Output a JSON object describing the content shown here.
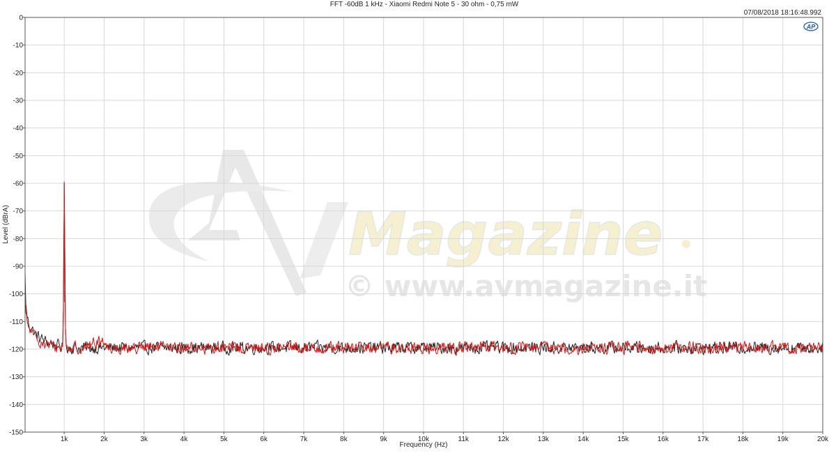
{
  "chart_data": {
    "type": "line",
    "title": "FFT -60dB 1 kHz - Xiaomi Redmi Note 5 - 30 ohm - 0,75 mW",
    "timestamp": "07/08/2018 18:16:48.992",
    "xlabel": "Frequency (Hz)",
    "ylabel": "Level (dBrA)",
    "xlim": [
      20,
      20000
    ],
    "ylim": [
      -150,
      0
    ],
    "x_ticks": [
      {
        "value": 1000,
        "label": "1k"
      },
      {
        "value": 2000,
        "label": "2k"
      },
      {
        "value": 3000,
        "label": "3k"
      },
      {
        "value": 4000,
        "label": "4k"
      },
      {
        "value": 5000,
        "label": "5k"
      },
      {
        "value": 6000,
        "label": "6k"
      },
      {
        "value": 7000,
        "label": "7k"
      },
      {
        "value": 8000,
        "label": "8k"
      },
      {
        "value": 9000,
        "label": "9k"
      },
      {
        "value": 10000,
        "label": "10k"
      },
      {
        "value": 11000,
        "label": "11k"
      },
      {
        "value": 12000,
        "label": "12k"
      },
      {
        "value": 13000,
        "label": "13k"
      },
      {
        "value": 14000,
        "label": "14k"
      },
      {
        "value": 15000,
        "label": "15k"
      },
      {
        "value": 16000,
        "label": "16k"
      },
      {
        "value": 17000,
        "label": "17k"
      },
      {
        "value": 18000,
        "label": "18k"
      },
      {
        "value": 19000,
        "label": "19k"
      },
      {
        "value": 20000,
        "label": "20k"
      }
    ],
    "y_ticks": [
      0,
      -10,
      -20,
      -30,
      -40,
      -50,
      -60,
      -70,
      -80,
      -90,
      -100,
      -110,
      -120,
      -130,
      -140,
      -150
    ],
    "grid": true,
    "series": [
      {
        "color": "#222222",
        "points": [
          [
            20,
            -93
          ],
          [
            30,
            -101
          ],
          [
            50,
            -106
          ],
          [
            80,
            -109
          ],
          [
            120,
            -111
          ],
          [
            200,
            -113
          ],
          [
            300,
            -115
          ],
          [
            400,
            -116
          ],
          [
            500,
            -117
          ],
          [
            600,
            -117.5
          ],
          [
            700,
            -118
          ],
          [
            800,
            -118.5
          ],
          [
            900,
            -119
          ],
          [
            960,
            -119
          ],
          [
            990,
            -100
          ],
          [
            1000,
            -60
          ],
          [
            1010,
            -100
          ],
          [
            1040,
            -119
          ],
          [
            1200,
            -119.5
          ],
          [
            1500,
            -119.5
          ],
          [
            2000,
            -119.5
          ],
          [
            3000,
            -119.5
          ],
          [
            4000,
            -119.5
          ],
          [
            5000,
            -119.5
          ],
          [
            6000,
            -119.5
          ],
          [
            7000,
            -119.5
          ],
          [
            8000,
            -119.5
          ],
          [
            9000,
            -119.5
          ],
          [
            10000,
            -119.5
          ],
          [
            11000,
            -119.5
          ],
          [
            12000,
            -119.5
          ],
          [
            13000,
            -119.5
          ],
          [
            14000,
            -119.5
          ],
          [
            15000,
            -119.5
          ],
          [
            16000,
            -119.5
          ],
          [
            17000,
            -119.5
          ],
          [
            18000,
            -119.5
          ],
          [
            19000,
            -119.5
          ],
          [
            20000,
            -119.5
          ]
        ]
      },
      {
        "color": "#dd1111",
        "points": [
          [
            20,
            -103
          ],
          [
            30,
            -106
          ],
          [
            50,
            -109
          ],
          [
            80,
            -111
          ],
          [
            120,
            -112.5
          ],
          [
            200,
            -114.5
          ],
          [
            300,
            -116
          ],
          [
            400,
            -117
          ],
          [
            500,
            -118
          ],
          [
            600,
            -118.5
          ],
          [
            700,
            -119
          ],
          [
            800,
            -119.5
          ],
          [
            900,
            -119.5
          ],
          [
            960,
            -119.5
          ],
          [
            990,
            -95
          ],
          [
            1000,
            -59.5
          ],
          [
            1010,
            -95
          ],
          [
            1040,
            -119.5
          ],
          [
            1200,
            -119.5
          ],
          [
            1500,
            -119.5
          ],
          [
            2000,
            -116.5
          ],
          [
            2050,
            -119.5
          ],
          [
            3000,
            -119.5
          ],
          [
            4000,
            -119.5
          ],
          [
            5000,
            -119.5
          ],
          [
            6000,
            -119.5
          ],
          [
            7000,
            -119.5
          ],
          [
            8000,
            -119.5
          ],
          [
            9000,
            -119.5
          ],
          [
            10000,
            -119.5
          ],
          [
            11000,
            -119.5
          ],
          [
            12000,
            -119.5
          ],
          [
            13000,
            -119.5
          ],
          [
            14000,
            -119.5
          ],
          [
            15000,
            -119.5
          ],
          [
            16000,
            -119.5
          ],
          [
            17000,
            -119.5
          ],
          [
            18000,
            -119.5
          ],
          [
            19000,
            -119.5
          ],
          [
            20000,
            -119.5
          ]
        ]
      }
    ],
    "noise_amplitude_db": 3
  },
  "logo": {
    "corner_label": "AP",
    "watermark_brand": "Magazine",
    "watermark_url": "© www.avmagazine.it"
  },
  "colors": {
    "grid": "#d8d8d8",
    "frame": "#555555",
    "watermark": "#e6e6e6",
    "watermark_accent": "#f5efc0",
    "ap_logo": "#1e5ab4"
  }
}
